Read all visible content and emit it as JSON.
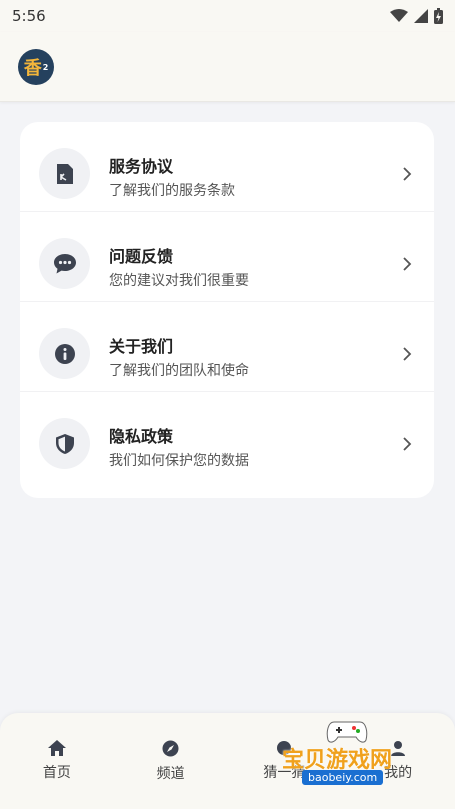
{
  "status_bar": {
    "time": "5:56"
  },
  "app_bar": {
    "logo_text": "香",
    "logo_superscript": "2"
  },
  "menu": {
    "items": [
      {
        "title": "服务协议",
        "subtitle": "了解我们的服务条款",
        "icon": "document-icon"
      },
      {
        "title": "问题反馈",
        "subtitle": "您的建议对我们很重要",
        "icon": "chat-bubble-icon"
      },
      {
        "title": "关于我们",
        "subtitle": "了解我们的团队和使命",
        "icon": "info-icon"
      },
      {
        "title": "隐私政策",
        "subtitle": "我们如何保护您的数据",
        "icon": "shield-icon"
      }
    ]
  },
  "bottom_nav": {
    "items": [
      {
        "label": "首页",
        "icon": "home-icon"
      },
      {
        "label": "频道",
        "icon": "compass-icon"
      },
      {
        "label": "猜一猜",
        "icon": "guess-icon"
      },
      {
        "label": "我的",
        "icon": "profile-icon"
      }
    ]
  },
  "watermark": {
    "text": "宝贝游戏网",
    "url": "baobeiy.com"
  },
  "colors": {
    "icon_dark": "#3d4350",
    "accent_logo": "#f2b53b",
    "logo_bg": "#25415e"
  }
}
